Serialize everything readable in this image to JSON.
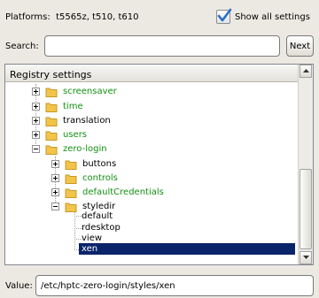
{
  "platforms": {
    "label": "Platforms:",
    "value": "t5565z, t510, t610"
  },
  "show_all": {
    "label": "Show all settings",
    "checked": true
  },
  "search": {
    "label": "Search:",
    "value": "",
    "next_label": "Next"
  },
  "tree": {
    "header": "Registry settings",
    "items": [
      {
        "label": "screensaver",
        "color": "#129012"
      },
      {
        "label": "time",
        "color": "#129012"
      },
      {
        "label": "translation",
        "color": "#000000"
      },
      {
        "label": "users",
        "color": "#129012"
      },
      {
        "label": "zero-login",
        "color": "#129012"
      },
      {
        "label": "buttons",
        "color": "#000000"
      },
      {
        "label": "controls",
        "color": "#129012"
      },
      {
        "label": "defaultCredentials",
        "color": "#129012"
      },
      {
        "label": "styledir",
        "color": "#000000"
      },
      {
        "label": "default",
        "color": "#000000"
      },
      {
        "label": "rdesktop",
        "color": "#000000"
      },
      {
        "label": "view",
        "color": "#000000"
      },
      {
        "label": "xen",
        "color": "#ffffff",
        "selected": true
      }
    ]
  },
  "value": {
    "label": "Value:",
    "value": "/etc/hptc-zero-login/styles/xen"
  }
}
